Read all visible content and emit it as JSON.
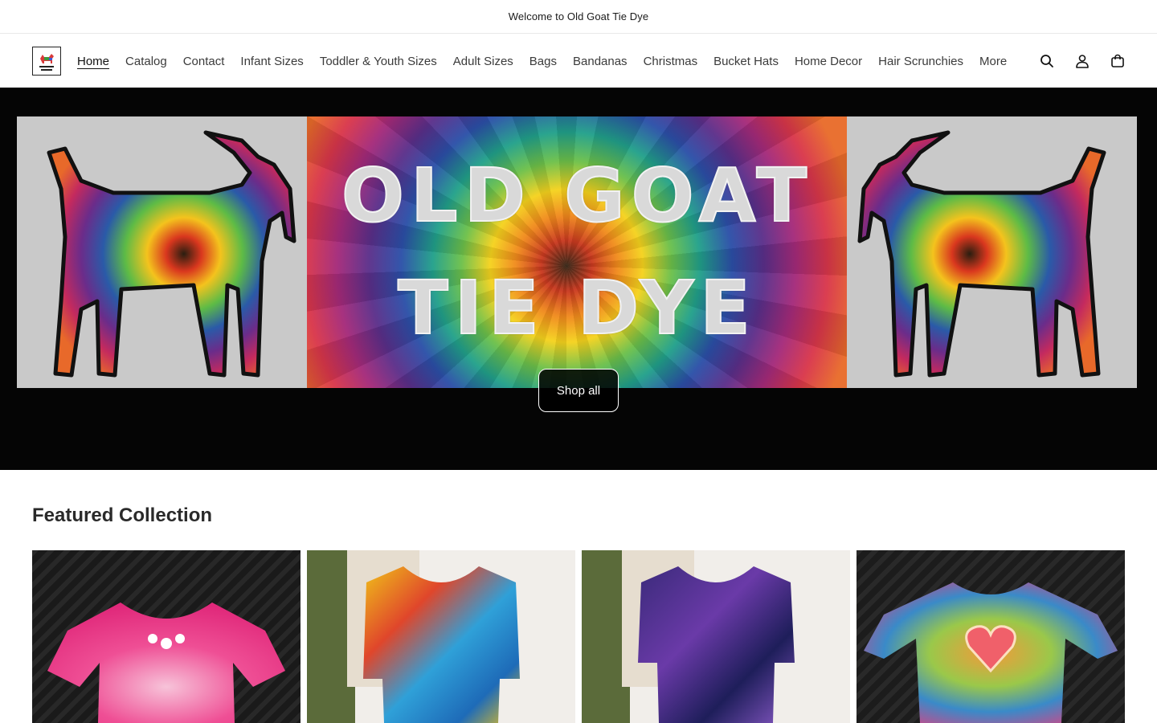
{
  "announcement": {
    "text": "Welcome to Old Goat Tie Dye"
  },
  "header": {
    "logo_alt": "Old Goat Tie Dye",
    "nav": [
      {
        "label": "Home",
        "active": true
      },
      {
        "label": "Catalog"
      },
      {
        "label": "Contact"
      },
      {
        "label": "Infant Sizes"
      },
      {
        "label": "Toddler & Youth Sizes"
      },
      {
        "label": "Adult Sizes"
      },
      {
        "label": "Bags"
      },
      {
        "label": "Bandanas"
      },
      {
        "label": "Christmas"
      },
      {
        "label": "Bucket Hats"
      },
      {
        "label": "Home Decor"
      },
      {
        "label": "Hair Scrunchies"
      },
      {
        "label": "More"
      }
    ],
    "icons": [
      "search-icon",
      "account-icon",
      "cart-icon"
    ]
  },
  "hero": {
    "banner_line1": "OLD GOAT",
    "banner_line2": "TIE DYE",
    "button_label": "Shop all"
  },
  "featured": {
    "title": "Featured Collection",
    "products": [
      {
        "image": "pink tie dye dress"
      },
      {
        "image": "rainbow tie dye tunic on mannequin"
      },
      {
        "image": "purple tie dye tunic on mannequin"
      },
      {
        "image": "rainbow tie dye heart onesie"
      }
    ]
  },
  "colors": {
    "hero_bg": "#050505",
    "text": "#121212",
    "border": "#e8e8e8"
  }
}
